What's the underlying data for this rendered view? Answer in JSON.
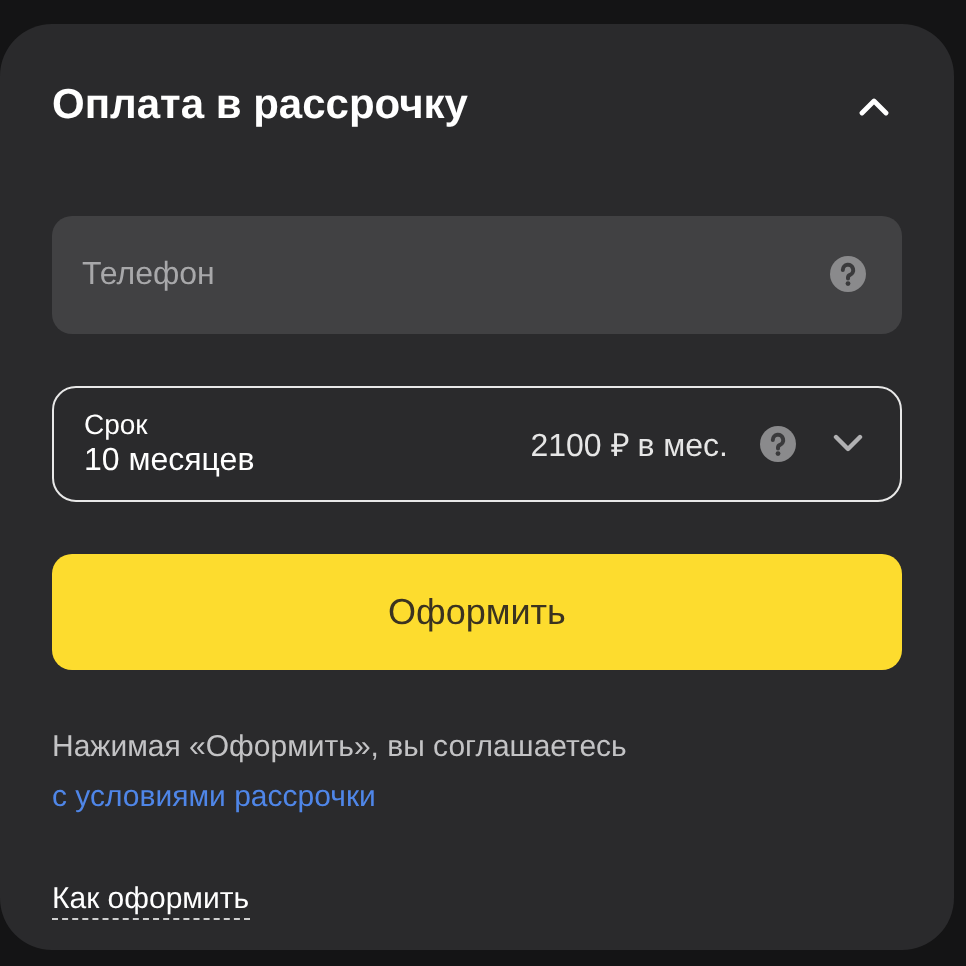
{
  "panel": {
    "title": "Оплата в рассрочку",
    "expanded": true
  },
  "phone_field": {
    "placeholder": "Телефон"
  },
  "term_field": {
    "label": "Срок",
    "value": "10 месяцев",
    "payment": "2100 ₽ в мес."
  },
  "submit_button": "Оформить",
  "notice": {
    "text": "Нажимая «Оформить», вы соглашаетесь",
    "link": "с условиями рассрочки"
  },
  "how_link": "Как оформить"
}
